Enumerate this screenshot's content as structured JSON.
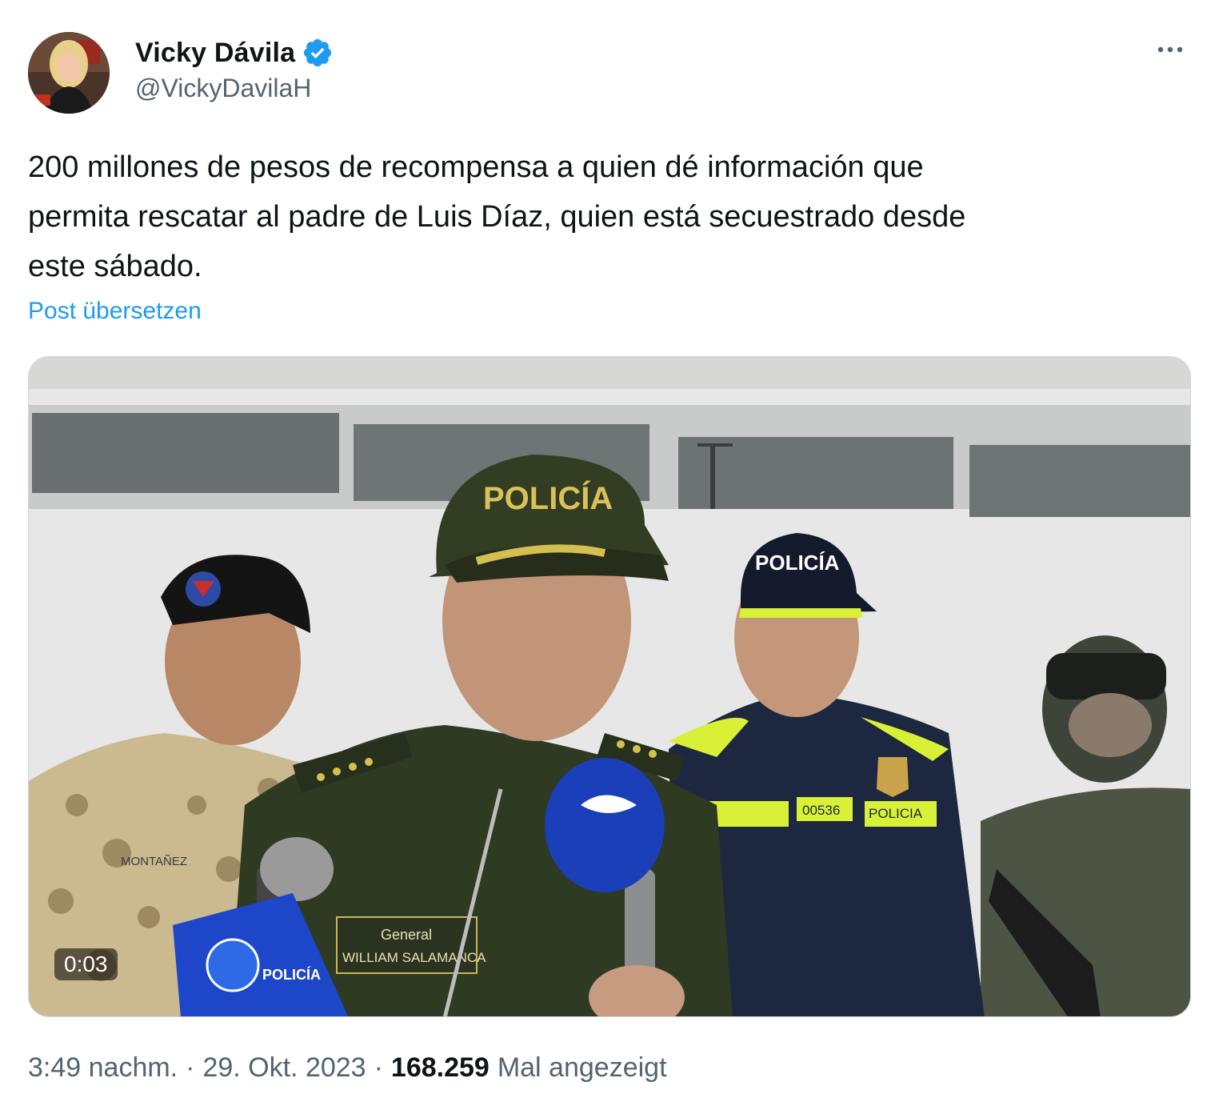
{
  "author": {
    "display_name": "Vicky Dávila",
    "handle": "@VickyDavilaH",
    "verified": true,
    "avatar_icon": "profile-photo"
  },
  "more_icon": "more-horizontal-icon",
  "tweet": {
    "text_lines": [
      "200 millones de pesos de recompensa a quien dé información que",
      "permita rescatar al padre de Luis Díaz, quien está secuestrado desde",
      "este sábado."
    ],
    "translate_label": "Post übersetzen"
  },
  "media": {
    "type": "video",
    "duration": "0:03",
    "cap_text": "POLICÍA",
    "cap_text_back": "POLICÍA",
    "nametag_rank": "General",
    "nametag_name": "WILLIAM SALAMANCA",
    "uniform_name_left": "MONTAÑEZ",
    "badge_number": "00536",
    "vest_label": "POLICIA",
    "mic_flag_text": "POLICÍA"
  },
  "meta": {
    "time": "3:49 nachm.",
    "separator": "·",
    "date": "29. Okt. 2023",
    "views_count": "168.259",
    "views_label": "Mal angezeigt"
  },
  "colors": {
    "accent": "#1d9bf0",
    "text_primary": "#0f1419",
    "text_secondary": "#536471",
    "border": "#cfd9de"
  }
}
